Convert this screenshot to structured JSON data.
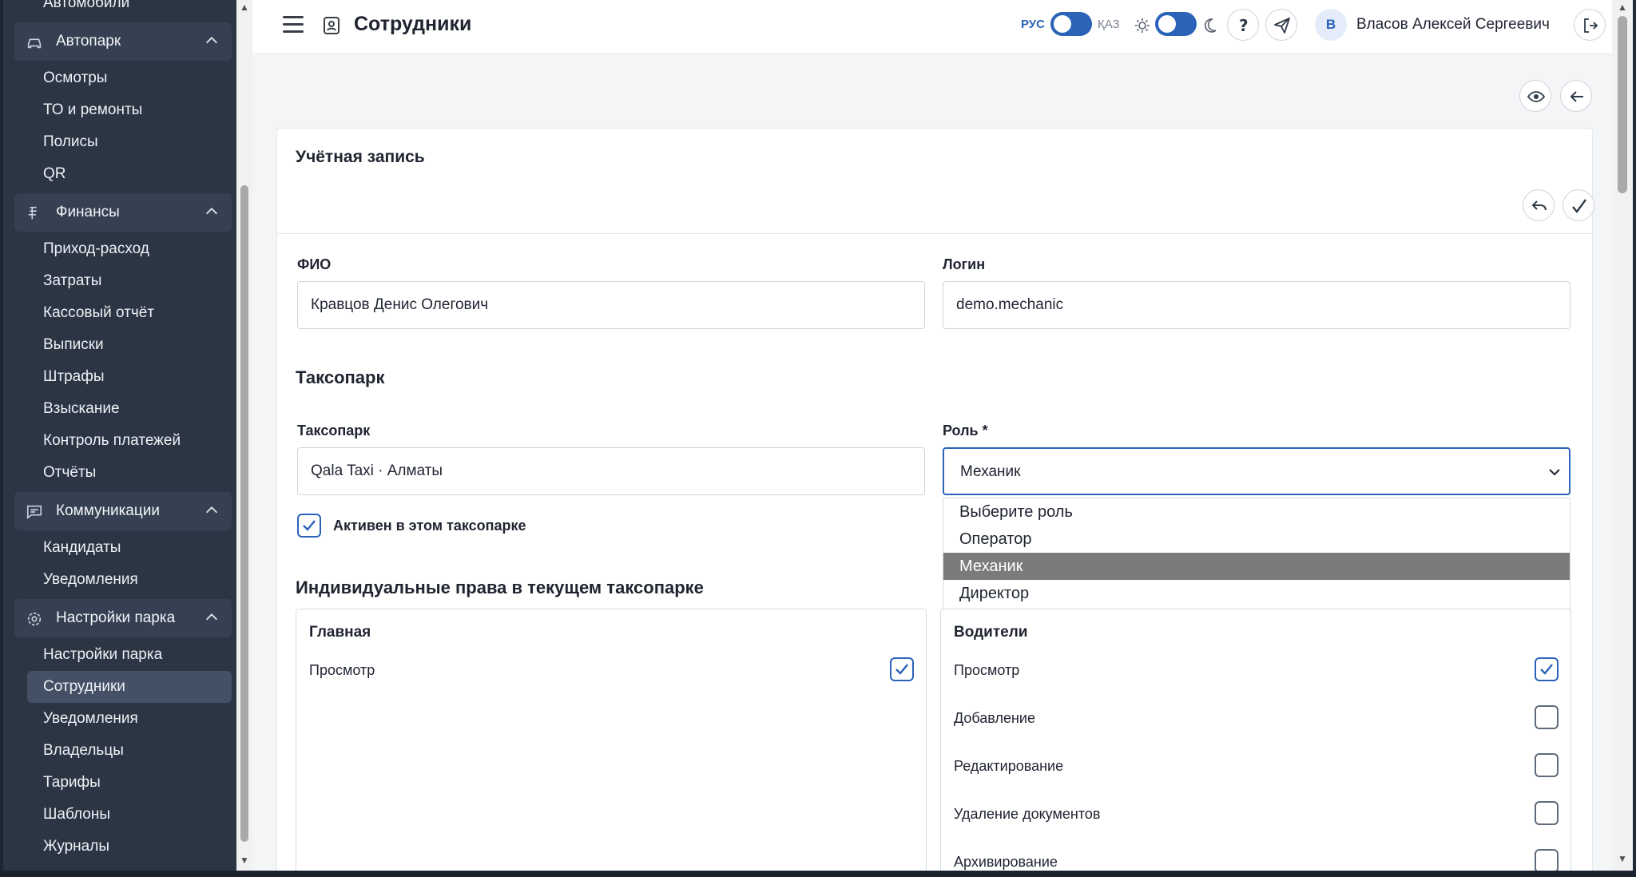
{
  "sidebar": {
    "top_item": "Автомобили",
    "groups": [
      {
        "label": "Автопарк",
        "icon": "car-icon",
        "items": [
          "Осмотры",
          "ТО и ремонты",
          "Полисы",
          "QR"
        ]
      },
      {
        "label": "Финансы",
        "icon": "finance-icon",
        "items": [
          "Приход-расход",
          "Затраты",
          "Кассовый отчёт",
          "Выписки",
          "Штрафы",
          "Взыскание",
          "Контроль платежей",
          "Отчёты"
        ]
      },
      {
        "label": "Коммуникации",
        "icon": "chat-icon",
        "items": [
          "Кандидаты",
          "Уведомления"
        ]
      },
      {
        "label": "Настройки парка",
        "icon": "settings-icon",
        "items": [
          "Настройки парка",
          "Сотрудники",
          "Уведомления",
          "Владельцы",
          "Тарифы",
          "Шаблоны",
          "Журналы"
        ]
      }
    ],
    "active_item": "Сотрудники"
  },
  "topbar": {
    "title": "Сотрудники",
    "lang_left": "РУС",
    "lang_right": "ҚАЗ",
    "user_initial": "В",
    "user_name": "Власов Алексей Сергеевич"
  },
  "form": {
    "card_title": "Учётная запись",
    "fio_label": "ФИО",
    "fio_value": "Кравцов Денис Олегович",
    "login_label": "Логин",
    "login_value": "demo.mechanic",
    "taxopark_section": "Таксопарк",
    "taxopark_label": "Таксопарк",
    "taxopark_value": "Qala Taxi · Алматы",
    "role_label": "Роль *",
    "role_value": "Механик",
    "active_label": "Активен в этом таксопарке",
    "active_checked": true,
    "role_options": [
      "Выберите роль",
      "Оператор",
      "Механик",
      "Директор"
    ],
    "role_selected_index": 2
  },
  "permissions": {
    "section_title": "Индивидуальные права в текущем таксопарке",
    "groups": [
      {
        "title": "Главная",
        "rows": [
          {
            "label": "Просмотр",
            "checked": true
          }
        ]
      },
      {
        "title": "Водители",
        "rows": [
          {
            "label": "Просмотр",
            "checked": true
          },
          {
            "label": "Добавление",
            "checked": false
          },
          {
            "label": "Редактирование",
            "checked": false
          },
          {
            "label": "Удаление документов",
            "checked": false
          },
          {
            "label": "Архивирование",
            "checked": false
          }
        ]
      }
    ]
  },
  "colors": {
    "accent": "#2a63b8",
    "sidebar_bg": "#2b3544",
    "sidebar_group_bg": "#354052",
    "sidebar_active_bg": "#435066",
    "dropdown_selected": "#7b7b7b"
  }
}
